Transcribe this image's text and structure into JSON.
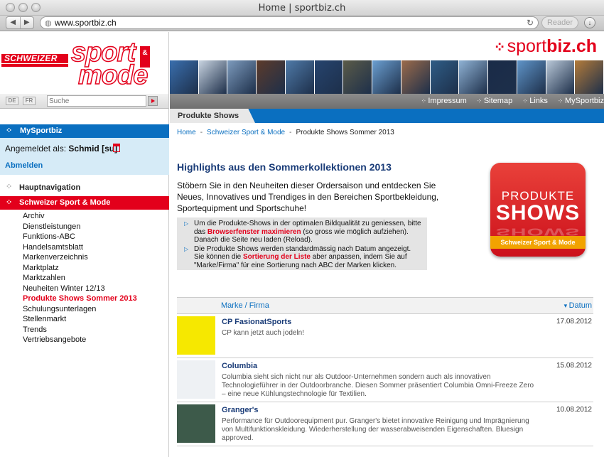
{
  "browser": {
    "title": "Home | sportbiz.ch",
    "url": "www.sportbiz.ch",
    "reader_label": "Reader"
  },
  "header": {
    "logo_schweizer": "SCHWEIZER",
    "logo_sport": "sport",
    "logo_mode": "mode",
    "logo_amp": "&",
    "brand_prefix": "sport",
    "brand_suffix": "biz.ch",
    "photo_colors": [
      "#3a6fae",
      "#c8d3e0",
      "#7d9bbd",
      "#5d3b2a",
      "#4f7aa8",
      "#26446e",
      "#5b5b48",
      "#6b9fd1",
      "#9c6b4a",
      "#2f5d86",
      "#8fb2d4",
      "#1a2b48",
      "#5f94c8",
      "#b9c8d8",
      "#b37b3a"
    ]
  },
  "langs": [
    "DE",
    "FR"
  ],
  "search": {
    "placeholder": "Suche"
  },
  "toplinks": [
    "Impressum",
    "Sitemap",
    "Links",
    "MySportbiz"
  ],
  "sidebar": {
    "mysportbiz": "MySportbiz",
    "logged_in_prefix": "Angemeldet als:",
    "logged_in_user": "Schmid [su]",
    "logout": "Abmelden",
    "main_nav": "Hauptnavigation",
    "section": "Schweizer Sport & Mode",
    "items": [
      "Archiv",
      "Dienstleistungen",
      "Funktions-ABC",
      "Handelsamtsblatt",
      "Markenverzeichnis",
      "Marktplatz",
      "Marktzahlen",
      "Neuheiten Winter 12/13",
      "Produkte Shows Sommer 2013",
      "Schulungsunterlagen",
      "Stellenmarkt",
      "Trends",
      "Vertriebsangebote"
    ],
    "active_index": 8
  },
  "main": {
    "tab": "Produkte Shows",
    "breadcrumb": [
      "Home",
      "Schweizer Sport & Mode",
      "Produkte Shows Sommer 2013"
    ],
    "heading": "Highlights aus den Sommerkollektionen 2013",
    "intro": "Stöbern Sie in den Neuheiten dieser Ordersaison und entdecken Sie Neues,  Innovatives und Trendiges in den Bereichen Sportbekleidung, Sportequipment und Sportschuhe!",
    "note1_a": "Um die Produkte-Shows in der optimalen Bildqualität zu geniessen, bitte das ",
    "note1_hl": "Browserfenster maximieren",
    "note1_b": " (so gross wie möglich aufziehen). Danach die Seite neu laden (Reload).",
    "note2_a": "Die Produkte Shows werden standardmässig nach Datum angezeigt. Sie können die ",
    "note2_hl": "Sortierung der Liste",
    "note2_b": " aber anpassen, indem Sie auf \"Marke/Firma\" für eine Sortierung nach ABC der Marken klicken.",
    "badge_top": "PRODUKTE",
    "badge_main": "SHOWS",
    "badge_strip": "Schweizer Sport & Mode",
    "col_brand": "Marke / Firma",
    "col_date": "Datum",
    "rows": [
      {
        "brand": "CP FasionatSports",
        "desc": "CP kann jetzt auch jodeln!",
        "date": "17.08.2012",
        "thumb": "#f6e800"
      },
      {
        "brand": "Columbia",
        "desc": "Columbia sieht sich nicht nur als Outdoor-Unternehmen sondern auch als innovativen Technologieführer in der Outdoorbranche. Diesen Sommer präsentiert Columbia Omni-Freeze Zero – eine neue Kühlungstechnologie für Textilien.",
        "date": "15.08.2012",
        "thumb": "#eef1f4"
      },
      {
        "brand": "Granger's",
        "desc": "Performance für Outdoorequipment pur. Granger's bietet innovative Reinigung und Imprägnierung von Multifunktionskleidung. Wiederherstellung der wasserabweisenden Eigenschaften. Bluesign approved.",
        "date": "10.08.2012",
        "thumb": "#3d5a4a"
      }
    ]
  }
}
